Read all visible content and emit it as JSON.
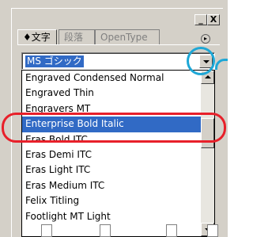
{
  "window": {
    "minimize_label": "_",
    "close_label": "X"
  },
  "tabs": [
    {
      "label": "♦文字"
    },
    {
      "label": "段落"
    },
    {
      "label": "OpenType"
    }
  ],
  "panel_menu_icon": "▸",
  "font_combo": {
    "value": "MS ゴシック"
  },
  "font_list": {
    "items": [
      "Engraved Condensed Normal",
      "Engraved Thin",
      "Engravers MT",
      "Enterprise  Bold Italic",
      "Eras Bold ITC",
      "Eras Demi ITC",
      "Eras Light ITC",
      "Eras Medium ITC",
      "Felix Titling",
      "Footlight MT Light"
    ],
    "selected_index": 3
  },
  "highlight_colors": {
    "selection_oval": "#e8202a",
    "button_circle": "#1ea7d6"
  }
}
